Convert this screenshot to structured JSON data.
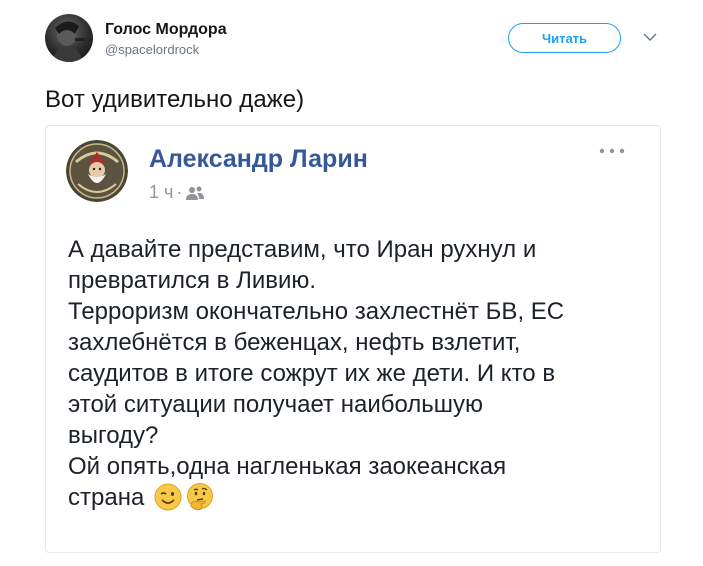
{
  "tweet": {
    "author": {
      "display_name": "Голос Мордора",
      "screen_name": "@spacelordrock",
      "avatar_icon": "profile-photo"
    },
    "follow_button_label": "Читать",
    "menu_icon": "chevron-down-icon",
    "text": "Вот удивительно даже)",
    "accent_color": "#1da1f2"
  },
  "embedded_post": {
    "author_name": "Александр Ларин",
    "time": "1 ч",
    "separator": "·",
    "audience_icon": "friends-icon",
    "more_icon": "ellipsis-icon",
    "body_lines": [
      "А давайте представим, что Иран рухнул и",
      "превратился в Ливию.",
      "Терроризм окончательно захлестнёт БВ, ЕС",
      "захлебнётся в беженцах, нефть взлетит,",
      "саудитов в итоге сожрут их же дети. И кто в",
      "этой ситуации получает наибольшую",
      "выгоду?",
      "Ой опять,одна нагленькая заокеанская",
      "страна"
    ],
    "emojis": [
      "wink-emoji",
      "thinking-emoji"
    ],
    "author_color": "#365899"
  }
}
